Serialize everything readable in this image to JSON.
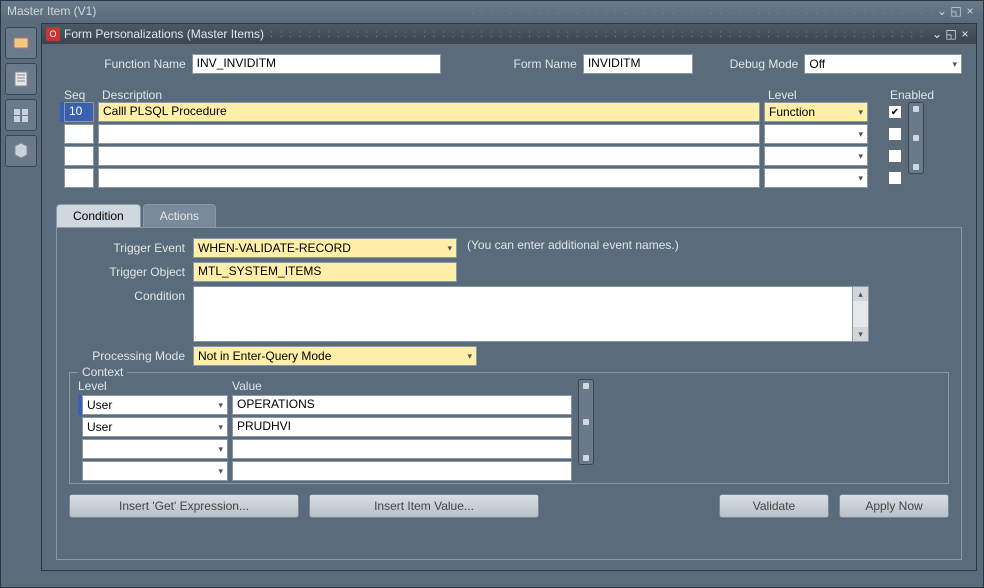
{
  "parent_window": {
    "title": "Master Item (V1)"
  },
  "window": {
    "title": "Form Personalizations (Master Items)"
  },
  "header": {
    "function_name_label": "Function Name",
    "function_name": "INV_INVIDITM",
    "form_name_label": "Form Name",
    "form_name": "INVIDITM",
    "debug_mode_label": "Debug Mode",
    "debug_mode": "Off"
  },
  "grid": {
    "headers": {
      "seq": "Seq",
      "description": "Description",
      "level": "Level",
      "enabled": "Enabled"
    },
    "rows": [
      {
        "seq": "10",
        "description": "Calll PLSQL Procedure",
        "level": "Function",
        "enabled": true,
        "active": true
      },
      {
        "seq": "",
        "description": "",
        "level": "",
        "enabled": false,
        "active": false
      },
      {
        "seq": "",
        "description": "",
        "level": "",
        "enabled": false,
        "active": false
      },
      {
        "seq": "",
        "description": "",
        "level": "",
        "enabled": false,
        "active": false
      }
    ]
  },
  "tabs": {
    "condition": "Condition",
    "actions": "Actions",
    "active": "condition"
  },
  "condition": {
    "trigger_event_label": "Trigger Event",
    "trigger_event": "WHEN-VALIDATE-RECORD",
    "trigger_event_hint": "(You can enter additional event names.)",
    "trigger_object_label": "Trigger Object",
    "trigger_object": "MTL_SYSTEM_ITEMS",
    "condition_label": "Condition",
    "condition_text": "",
    "processing_mode_label": "Processing Mode",
    "processing_mode": "Not in Enter-Query Mode",
    "context": {
      "legend": "Context",
      "headers": {
        "level": "Level",
        "value": "Value"
      },
      "rows": [
        {
          "level": "User",
          "value": "OPERATIONS",
          "active": true
        },
        {
          "level": "User",
          "value": "PRUDHVI",
          "active": false
        },
        {
          "level": "",
          "value": "",
          "active": false
        },
        {
          "level": "",
          "value": "",
          "active": false
        }
      ]
    }
  },
  "buttons": {
    "insert_get": "Insert 'Get' Expression...",
    "insert_item": "Insert Item Value...",
    "validate": "Validate",
    "apply_now": "Apply Now"
  }
}
